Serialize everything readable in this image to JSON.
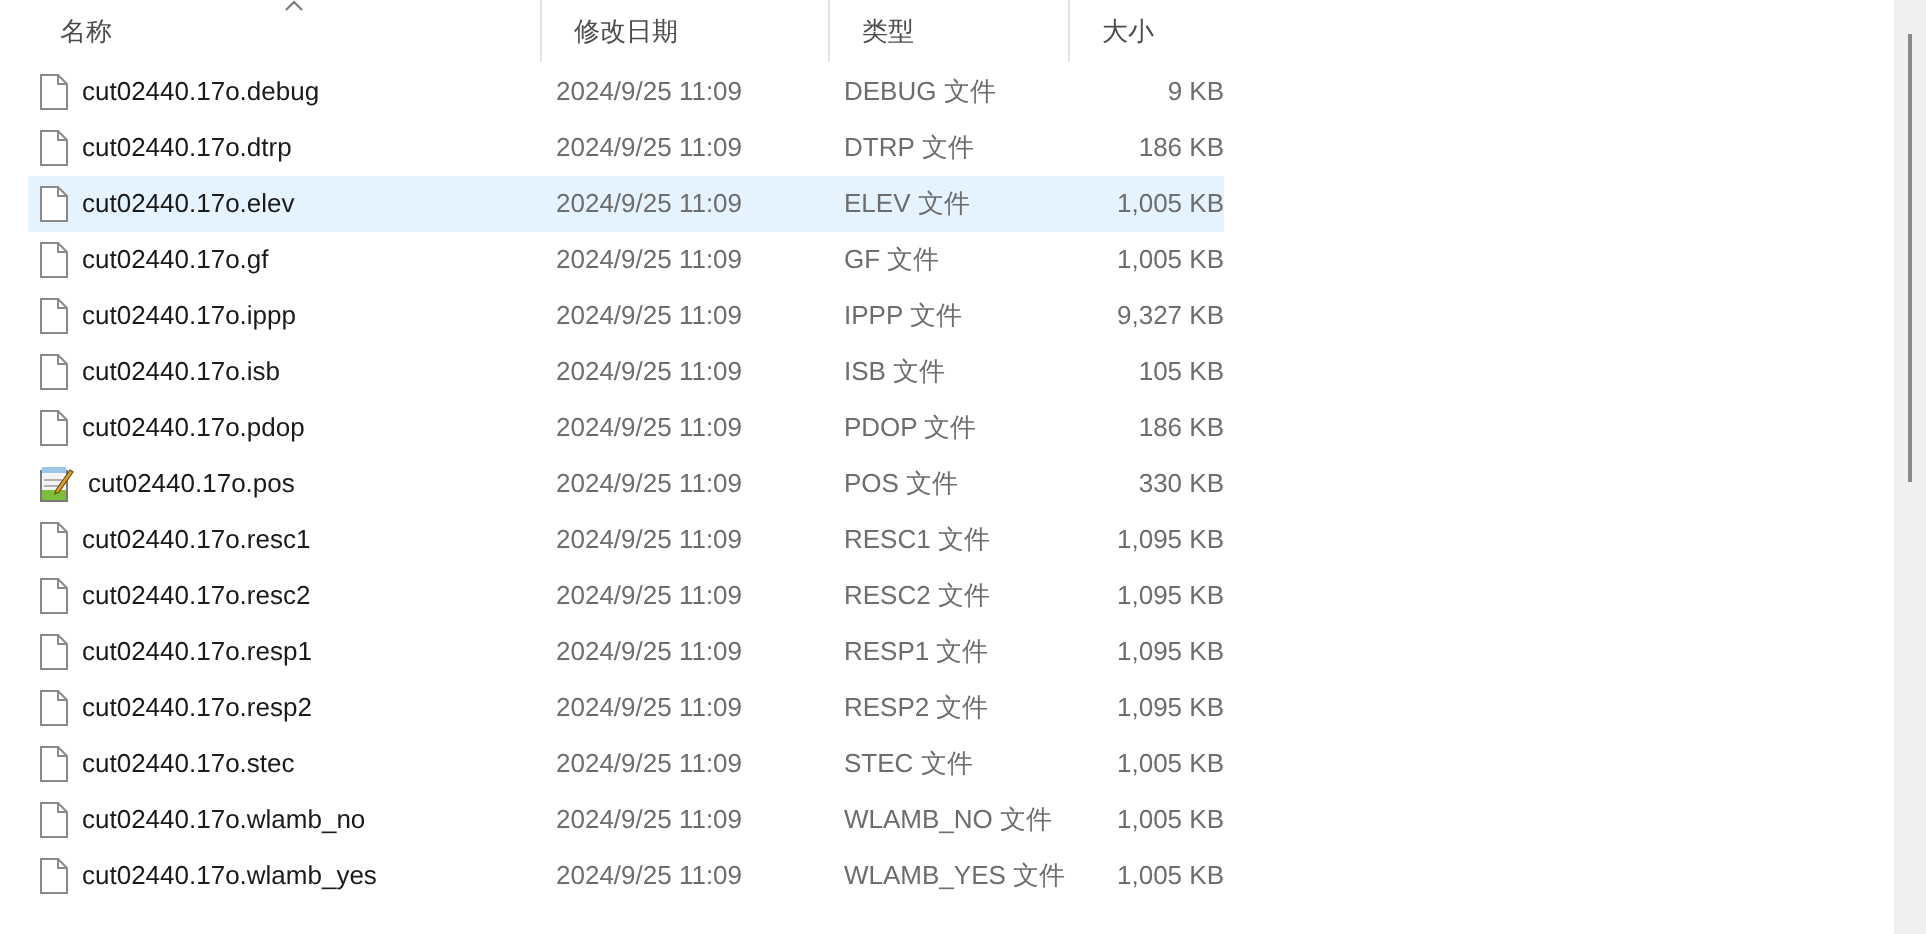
{
  "columns": [
    {
      "label": "名称",
      "sorted": true
    },
    {
      "label": "修改日期",
      "sorted": false
    },
    {
      "label": "类型",
      "sorted": false
    },
    {
      "label": "大小",
      "sorted": false
    }
  ],
  "rows": [
    {
      "name": "cut02440.17o.debug",
      "modified": "2024/9/25 11:09",
      "type": "DEBUG 文件",
      "size": "9 KB",
      "kind": "file",
      "selected": false
    },
    {
      "name": "cut02440.17o.dtrp",
      "modified": "2024/9/25 11:09",
      "type": "DTRP 文件",
      "size": "186 KB",
      "kind": "file",
      "selected": false
    },
    {
      "name": "cut02440.17o.elev",
      "modified": "2024/9/25 11:09",
      "type": "ELEV 文件",
      "size": "1,005 KB",
      "kind": "file",
      "selected": true
    },
    {
      "name": "cut02440.17o.gf",
      "modified": "2024/9/25 11:09",
      "type": "GF 文件",
      "size": "1,005 KB",
      "kind": "file",
      "selected": false
    },
    {
      "name": "cut02440.17o.ippp",
      "modified": "2024/9/25 11:09",
      "type": "IPPP 文件",
      "size": "9,327 KB",
      "kind": "file",
      "selected": false
    },
    {
      "name": "cut02440.17o.isb",
      "modified": "2024/9/25 11:09",
      "type": "ISB 文件",
      "size": "105 KB",
      "kind": "file",
      "selected": false
    },
    {
      "name": "cut02440.17o.pdop",
      "modified": "2024/9/25 11:09",
      "type": "PDOP 文件",
      "size": "186 KB",
      "kind": "file",
      "selected": false
    },
    {
      "name": "cut02440.17o.pos",
      "modified": "2024/9/25 11:09",
      "type": "POS 文件",
      "size": "330 KB",
      "kind": "text",
      "selected": false
    },
    {
      "name": "cut02440.17o.resc1",
      "modified": "2024/9/25 11:09",
      "type": "RESC1 文件",
      "size": "1,095 KB",
      "kind": "file",
      "selected": false
    },
    {
      "name": "cut02440.17o.resc2",
      "modified": "2024/9/25 11:09",
      "type": "RESC2 文件",
      "size": "1,095 KB",
      "kind": "file",
      "selected": false
    },
    {
      "name": "cut02440.17o.resp1",
      "modified": "2024/9/25 11:09",
      "type": "RESP1 文件",
      "size": "1,095 KB",
      "kind": "file",
      "selected": false
    },
    {
      "name": "cut02440.17o.resp2",
      "modified": "2024/9/25 11:09",
      "type": "RESP2 文件",
      "size": "1,095 KB",
      "kind": "file",
      "selected": false
    },
    {
      "name": "cut02440.17o.stec",
      "modified": "2024/9/25 11:09",
      "type": "STEC 文件",
      "size": "1,005 KB",
      "kind": "file",
      "selected": false
    },
    {
      "name": "cut02440.17o.wlamb_no",
      "modified": "2024/9/25 11:09",
      "type": "WLAMB_NO 文件",
      "size": "1,005 KB",
      "kind": "file",
      "selected": false
    },
    {
      "name": "cut02440.17o.wlamb_yes",
      "modified": "2024/9/25 11:09",
      "type": "WLAMB_YES 文件",
      "size": "1,005 KB",
      "kind": "file",
      "selected": false
    }
  ]
}
